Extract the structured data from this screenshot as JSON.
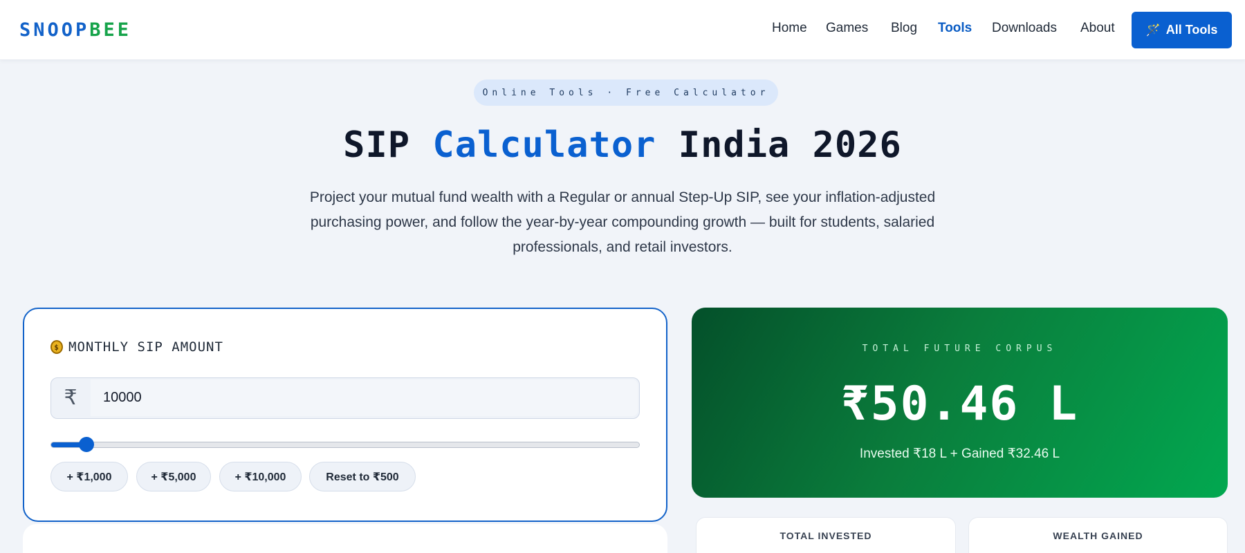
{
  "header": {
    "logo": {
      "part1": "SNOOP",
      "part2": "BEE"
    },
    "nav": [
      {
        "label": "Home",
        "active": false
      },
      {
        "label": "Games",
        "active": false
      },
      {
        "label": "Blog",
        "active": false
      },
      {
        "label": "Tools",
        "active": true
      },
      {
        "label": "Downloads",
        "active": false
      },
      {
        "label": "About",
        "active": false
      }
    ],
    "cta": {
      "label": "All Tools",
      "icon": "magic-wand-icon"
    }
  },
  "hero": {
    "pill": "Online Tools · Free Calculator",
    "title_pre": "SIP ",
    "title_accent": "Calculator",
    "title_post": " India 2026",
    "subtitle": "Project your mutual fund wealth with a Regular or annual Step-Up SIP, see your inflation-adjusted purchasing power, and follow the year-by-year compounding growth — built for students, salaried professionals, and retail investors."
  },
  "sip_input": {
    "label": "MONTHLY SIP AMOUNT",
    "icon": "money-bag-icon",
    "currency_symbol": "₹",
    "value": "10000",
    "slider_fraction": 0.06,
    "chips": [
      "+ ₹1,000",
      "+ ₹5,000",
      "+ ₹10,000",
      "Reset to ₹500"
    ]
  },
  "result": {
    "label": "TOTAL FUTURE CORPUS",
    "value": "₹50.46 L",
    "breakdown": "Invested ₹18 L + Gained ₹32.46 L"
  },
  "stats": [
    {
      "label": "TOTAL INVESTED"
    },
    {
      "label": "WEALTH GAINED"
    }
  ],
  "colors": {
    "brand_blue": "#0a60d0",
    "brand_green": "#16a34a",
    "corpus_gradient_start": "#04502a",
    "corpus_gradient_end": "#02a850"
  }
}
